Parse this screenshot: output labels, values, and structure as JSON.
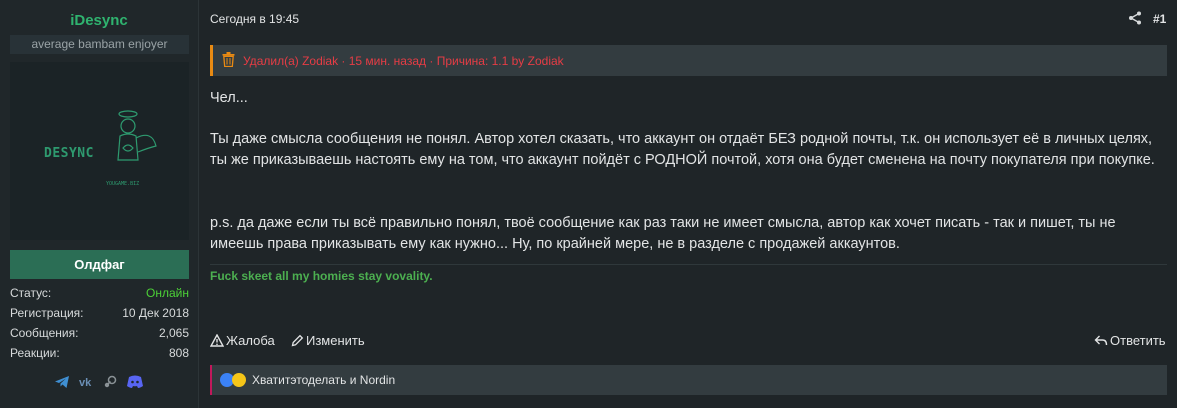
{
  "user": {
    "username": "iDesync",
    "title": "average bambam enjoyer",
    "avatar_text": "DESYNC",
    "avatar_subtext": "YOUGAME.BIZ",
    "rank": "Олдфаг",
    "stats": [
      {
        "label": "Статус:",
        "value": "Онлайн"
      },
      {
        "label": "Регистрация:",
        "value": "10 Дек 2018"
      },
      {
        "label": "Сообщения:",
        "value": "2,065"
      },
      {
        "label": "Реакции:",
        "value": "808"
      }
    ],
    "socials": [
      "telegram-icon",
      "vk-icon",
      "steam-icon",
      "discord-icon"
    ]
  },
  "post": {
    "date": "Сегодня в 19:45",
    "number": "#1",
    "deleted_notice": "Удалил(а) Zodiak · 15 мин. назад · Причина: 1.1 by Zodiak",
    "paragraphs": [
      "Чел...",
      "Ты даже смысла сообщения не понял. Автор хотел сказать, что аккаунт он отдаёт БЕЗ родной почты, т.к. он использует её в личных целях, ты же приказываешь настоять ему на том, что аккаунт пойдёт с РОДНОЙ почтой, хотя она будет сменена на почту покупателя при покупке.",
      "p.s. да даже если ты всё правильно понял, твоё сообщение как раз таки не имеет смысла, автор как хочет писать - так и пишет, ты не имеешь права приказывать ему как нужно... Ну, по крайней мере, не в разделе с продажей аккаунтов."
    ],
    "signature": "Fuck skeet all my homies stay vovality.",
    "actions": {
      "report": "Жалоба",
      "edit": "Изменить",
      "reply": "Ответить"
    },
    "reactions_text": "Хватитэтоделать и Nordin"
  },
  "colors": {
    "accent": "#2fb36f",
    "online": "#4cd137",
    "deleted_border": "#e88a13",
    "deleted_text": "#e63c45",
    "rank_bg": "#2b6e55"
  }
}
